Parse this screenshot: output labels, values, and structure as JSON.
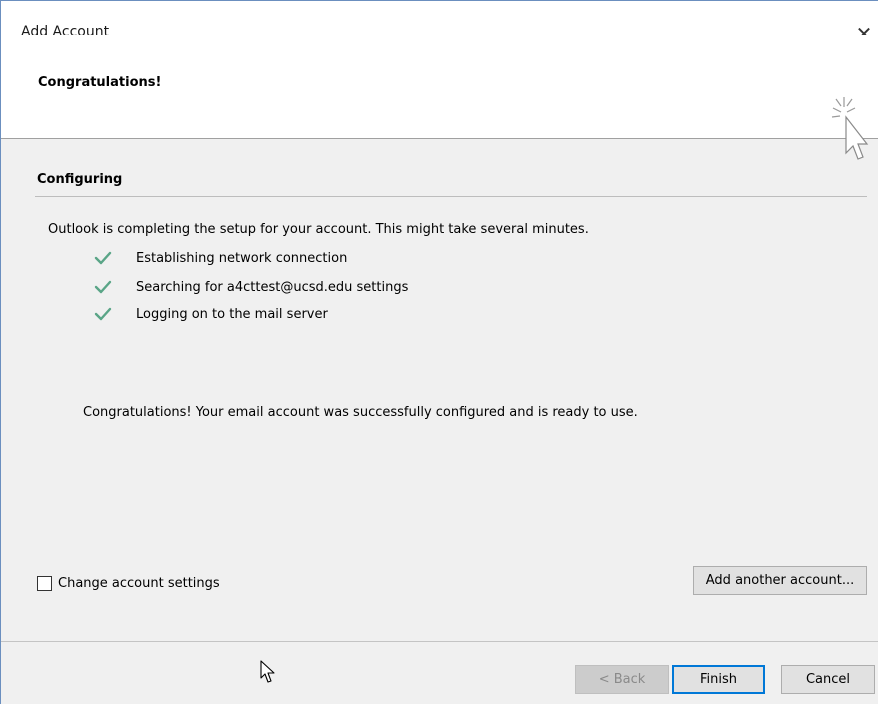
{
  "window": {
    "title": "Add Account",
    "close_glyph": "✕"
  },
  "header": {
    "title": "Congratulations!",
    "icon": "wizard-cursor-sparkle-icon"
  },
  "section": {
    "title": "Configuring"
  },
  "intro": "Outlook is completing the setup for your account. This might take several minutes.",
  "steps": [
    {
      "label": "Establishing network connection",
      "status": "done"
    },
    {
      "label": "Searching for a4cttest@ucsd.edu settings",
      "status": "done"
    },
    {
      "label": "Logging on to the mail server",
      "status": "done"
    }
  ],
  "message": "Congratulations! Your email account was successfully configured and is ready to use.",
  "options": {
    "change_settings_label": "Change account settings",
    "change_settings_checked": false
  },
  "buttons": {
    "add_another": "Add another account...",
    "back": "< Back",
    "finish": "Finish",
    "cancel": "Cancel"
  },
  "colors": {
    "check": "#5aa587",
    "accent": "#0078d7"
  }
}
